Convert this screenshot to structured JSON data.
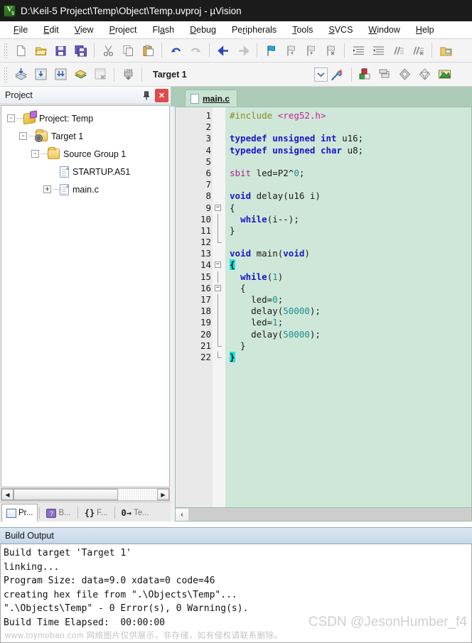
{
  "titlebar": {
    "icon": "uvision-logo-icon",
    "text": "D:\\Keil-5 Project\\Temp\\Object\\Temp.uvproj - µVision"
  },
  "menubar": {
    "items": [
      {
        "label": "File",
        "accel": "F"
      },
      {
        "label": "Edit",
        "accel": "E"
      },
      {
        "label": "View",
        "accel": "V"
      },
      {
        "label": "Project",
        "accel": "P"
      },
      {
        "label": "Flash",
        "accel": "a"
      },
      {
        "label": "Debug",
        "accel": "D"
      },
      {
        "label": "Peripherals",
        "accel": "r"
      },
      {
        "label": "Tools",
        "accel": "T"
      },
      {
        "label": "SVCS",
        "accel": "S"
      },
      {
        "label": "Window",
        "accel": "W"
      },
      {
        "label": "Help",
        "accel": "H"
      }
    ]
  },
  "toolbar_main": {
    "buttons": [
      {
        "name": "new-file-icon"
      },
      {
        "name": "open-file-icon"
      },
      {
        "name": "save-icon"
      },
      {
        "name": "save-all-icon"
      },
      {
        "name": "separator"
      },
      {
        "name": "cut-icon"
      },
      {
        "name": "copy-icon"
      },
      {
        "name": "paste-icon"
      },
      {
        "name": "separator"
      },
      {
        "name": "undo-icon"
      },
      {
        "name": "redo-icon"
      },
      {
        "name": "separator"
      },
      {
        "name": "navigate-back-icon"
      },
      {
        "name": "navigate-forward-icon"
      },
      {
        "name": "separator"
      },
      {
        "name": "bookmark-toggle-icon"
      },
      {
        "name": "bookmark-prev-icon"
      },
      {
        "name": "bookmark-next-icon"
      },
      {
        "name": "bookmark-clear-icon"
      },
      {
        "name": "separator"
      },
      {
        "name": "indent-icon"
      },
      {
        "name": "outdent-icon"
      },
      {
        "name": "comment-icon"
      },
      {
        "name": "uncomment-icon"
      },
      {
        "name": "separator"
      },
      {
        "name": "open-project-icon"
      }
    ]
  },
  "toolbar_build": {
    "buttons": [
      {
        "name": "translate-icon"
      },
      {
        "name": "build-icon"
      },
      {
        "name": "rebuild-icon"
      },
      {
        "name": "batch-build-icon"
      },
      {
        "name": "stop-build-icon"
      },
      {
        "name": "separator"
      },
      {
        "name": "download-icon"
      },
      {
        "name": "separator"
      }
    ],
    "target_value": "Target 1",
    "after_buttons": [
      {
        "name": "target-options-icon"
      },
      {
        "name": "separator"
      },
      {
        "name": "manage-components-icon"
      },
      {
        "name": "multi-project-icon"
      },
      {
        "name": "pack-installer-icon"
      },
      {
        "name": "pack-filter-icon"
      },
      {
        "name": "manage-runtime-icon"
      }
    ]
  },
  "project_panel": {
    "title": "Project",
    "pin_icon": "pin-icon",
    "close_icon": "close-icon",
    "tree": [
      {
        "level": 0,
        "label": "Project: Temp",
        "icon": "project-icon",
        "expander": "-"
      },
      {
        "level": 1,
        "label": "Target 1",
        "icon": "target-folder-icon",
        "expander": "-"
      },
      {
        "level": 2,
        "label": "Source Group 1",
        "icon": "folder-icon",
        "expander": "-"
      },
      {
        "level": 3,
        "label": "STARTUP.A51",
        "icon": "file-icon",
        "expander": ""
      },
      {
        "level": 3,
        "label": "main.c",
        "icon": "file-icon",
        "expander": "+"
      }
    ],
    "tabs": [
      {
        "label": "Pr...",
        "icon": "project-tab-icon",
        "active": true
      },
      {
        "label": "B...",
        "icon": "books-tab-icon",
        "active": false
      },
      {
        "label": "F...",
        "icon": "functions-tab-icon",
        "active": false
      },
      {
        "label": "Te...",
        "icon": "templates-tab-icon",
        "active": false
      }
    ]
  },
  "editor": {
    "tab": {
      "label": "main.c",
      "icon": "c-file-icon"
    },
    "lines": [
      {
        "n": 1,
        "fold": "",
        "text": "#include <reg52.h>"
      },
      {
        "n": 2,
        "fold": "",
        "text": ""
      },
      {
        "n": 3,
        "fold": "",
        "text": "typedef unsigned int u16;"
      },
      {
        "n": 4,
        "fold": "",
        "text": "typedef unsigned char u8;"
      },
      {
        "n": 5,
        "fold": "",
        "text": ""
      },
      {
        "n": 6,
        "fold": "",
        "text": "sbit led=P2^0;"
      },
      {
        "n": 7,
        "fold": "",
        "text": ""
      },
      {
        "n": 8,
        "fold": "",
        "text": "void delay(u16 i)"
      },
      {
        "n": 9,
        "fold": "-",
        "text": "{"
      },
      {
        "n": 10,
        "fold": "|",
        "text": "  while(i--);"
      },
      {
        "n": 11,
        "fold": "|",
        "text": "}"
      },
      {
        "n": 12,
        "fold": "L",
        "text": ""
      },
      {
        "n": 13,
        "fold": "",
        "text": "void main(void)"
      },
      {
        "n": 14,
        "fold": "-",
        "text": "{"
      },
      {
        "n": 15,
        "fold": "|",
        "text": "  while(1)"
      },
      {
        "n": 16,
        "fold": "-",
        "text": "  {"
      },
      {
        "n": 17,
        "fold": "|",
        "text": "    led=0;"
      },
      {
        "n": 18,
        "fold": "|",
        "text": "    delay(50000);"
      },
      {
        "n": 19,
        "fold": "|",
        "text": "    led=1;"
      },
      {
        "n": 20,
        "fold": "|",
        "text": "    delay(50000);"
      },
      {
        "n": 21,
        "fold": "L",
        "text": "  }"
      },
      {
        "n": 22,
        "fold": "L",
        "text": "}"
      }
    ]
  },
  "build_output": {
    "title": "Build Output",
    "lines": [
      "Build target 'Target 1'",
      "linking...",
      "Program Size: data=9.0 xdata=0 code=46",
      "creating hex file from \".\\Objects\\Temp\"...",
      "\".\\Objects\\Temp\" - 0 Error(s), 0 Warning(s).",
      "Build Time Elapsed:  00:00:00"
    ]
  },
  "watermarks": {
    "left": "www.toymoban.com 网络图片仅供展示，非存储，如有侵权请联系删除。",
    "right": "CSDN @JesonHumber_f4"
  },
  "colors": {
    "titlebar_bg": "#1b1b1b",
    "editor_bg": "#cfe7d8",
    "tabstrip_bg": "#adccb8",
    "keyword": "#1818c8",
    "preprocessor": "#8a8a22",
    "include_path": "#c41fa0",
    "number": "#1a9090",
    "sbit": "#b0228c",
    "brace_highlight": "#18e6e6",
    "build_head_bg": "#c6d7e8",
    "close_button": "#e04a4a"
  }
}
